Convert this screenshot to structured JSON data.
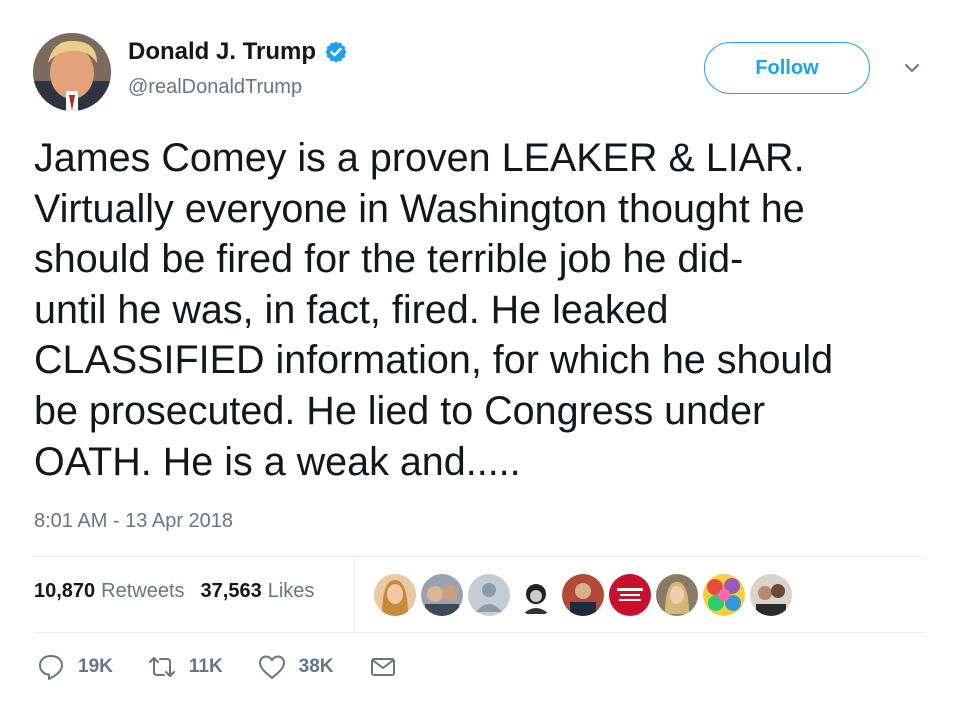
{
  "author": {
    "display_name": "Donald J. Trump",
    "handle": "@realDonaldTrump",
    "verified": true
  },
  "follow_label": "Follow",
  "tweet_text": "James Comey is a proven LEAKER & LIAR.\nVirtually everyone in Washington thought he\nshould be fired for the terrible job he did-\nuntil he was, in fact, fired. He leaked\nCLASSIFIED information, for which he should\nbe prosecuted. He lied to Congress under\nOATH. He is a weak and.....",
  "timestamp": "8:01 AM - 13 Apr 2018",
  "stats": {
    "retweets_count": "10,870",
    "retweets_label": "Retweets",
    "likes_count": "37,563",
    "likes_label": "Likes"
  },
  "actions": {
    "reply_count": "19K",
    "retweet_count": "11K",
    "like_count": "38K"
  },
  "colors": {
    "accent": "#1da1f2",
    "secondary_text": "#657786",
    "divider": "#e6ecf0"
  },
  "icons": [
    "verified-badge-icon",
    "chevron-down-icon",
    "reply-icon",
    "retweet-icon",
    "heart-icon",
    "envelope-icon"
  ],
  "liker_avatar_count": 9
}
